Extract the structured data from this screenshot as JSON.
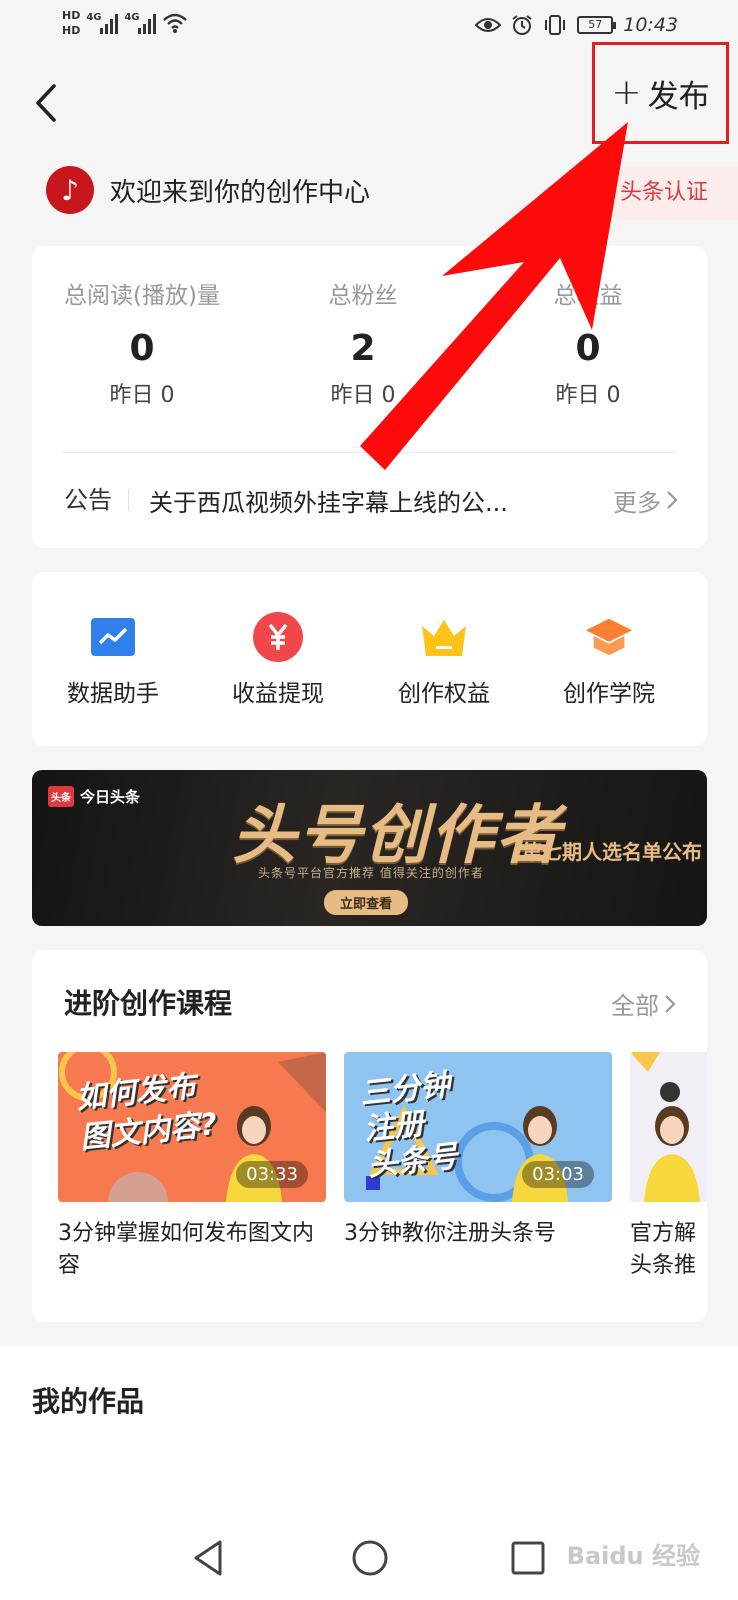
{
  "status_bar": {
    "hd1": "HD",
    "hd2": "HD",
    "net1": "4G",
    "net2": "4G",
    "battery": "57",
    "time": "10:43"
  },
  "header": {
    "publish_label": "发布"
  },
  "welcome": {
    "text": "欢迎来到你的创作中心",
    "cert_label": "头条认证",
    "avatar_letter": "♪"
  },
  "stats": [
    {
      "label": "总阅读(播放)量",
      "value": "0",
      "yesterday": "昨日 0"
    },
    {
      "label": "总粉丝",
      "value": "2",
      "yesterday": "昨日 0"
    },
    {
      "label": "总收益",
      "value": "0",
      "yesterday": "昨日 0"
    }
  ],
  "notice": {
    "tag": "公告",
    "text": "关于西瓜视频外挂字幕上线的公...",
    "more": "更多"
  },
  "tools": [
    {
      "label": "数据助手",
      "icon": "chart-icon",
      "color": "#2f80ed"
    },
    {
      "label": "收益提现",
      "icon": "yuan-icon",
      "color": "#f0474a"
    },
    {
      "label": "创作权益",
      "icon": "crown-icon",
      "color": "#ffc21a"
    },
    {
      "label": "创作学院",
      "icon": "graduation-cap-icon",
      "color": "#ff7f32"
    }
  ],
  "banner": {
    "brand": "今日头条",
    "brand_logo": "头条",
    "title": "头号创作者",
    "subtitle": "头条号平台官方推荐 值得关注的创作者",
    "button": "立即查看",
    "right_text": "第七期人选名单公布"
  },
  "courses": {
    "title": "进阶创作课程",
    "all_label": "全部",
    "items": [
      {
        "thumb_text": "如何发布\n图文内容?",
        "duration": "03:33",
        "name": "3分钟掌握如何发布图文内容",
        "bg": "#f7794f"
      },
      {
        "thumb_text": "三分钟\n注册\n头条号",
        "duration": "03:03",
        "name": "3分钟教你注册头条号",
        "bg": "#8fc3f0"
      },
      {
        "thumb_text": "",
        "duration": "",
        "name": "官方解\n头条推",
        "bg": "#f2eef5"
      }
    ]
  },
  "works": {
    "title": "我的作品"
  },
  "watermark": "Baidu 经验"
}
